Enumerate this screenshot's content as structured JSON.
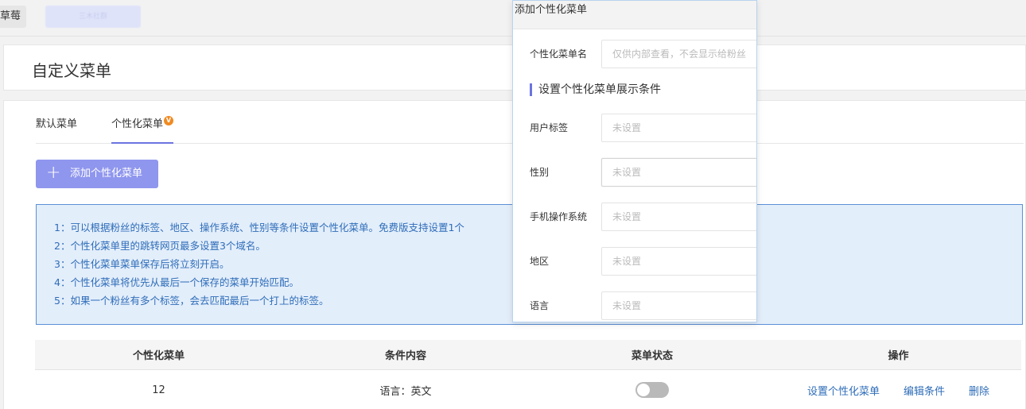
{
  "topbar": {
    "tab1_label": "草莓",
    "tab2_label": "三木社群"
  },
  "page": {
    "title": "自定义菜单"
  },
  "tabs": {
    "default_label": "默认菜单",
    "personal_label": "个性化菜单",
    "vip_badge": "V"
  },
  "toolbar": {
    "add_label": "添加个性化菜单",
    "plus": "+"
  },
  "tips": [
    "1：可以根据粉丝的标签、地区、操作系统、性别等条件设置个性化菜单。免费版支持设置1个",
    "2：个性化菜单里的跳转网页最多设置3个域名。",
    "3：个性化菜单菜单保存后将立刻开启。",
    "4：个性化菜单将优先从最后一个保存的菜单开始匹配。",
    "5：如果一个粉丝有多个标签，会去匹配最后一个打上的标签。"
  ],
  "table": {
    "headers": [
      "个性化菜单",
      "条件内容",
      "菜单状态",
      "操作"
    ],
    "rows": [
      {
        "name": "12",
        "condition": "语言：英文",
        "status": "off",
        "actions": [
          "设置个性化菜单",
          "编辑条件",
          "删除"
        ]
      }
    ]
  },
  "dialog": {
    "title": "添加个性化菜单",
    "name_label": "个性化菜单名",
    "name_placeholder": "仅供内部查看，不会显示给粉丝",
    "section_title": "设置个性化菜单展示条件",
    "fields": [
      {
        "label": "用户标签",
        "value": "未设置"
      },
      {
        "label": "性别",
        "value": "未设置"
      },
      {
        "label": "手机操作系统",
        "value": "未设置"
      },
      {
        "label": "地区",
        "value": "未设置"
      },
      {
        "label": "语言",
        "value": "未设置"
      }
    ]
  },
  "colors": {
    "accent": "#8f96ee",
    "tab_underline": "#6b74e0",
    "tips_bg": "#e3eefb",
    "tips_text": "#2f6db8",
    "link": "#2f6db8",
    "vip_badge": "#f08a22"
  }
}
